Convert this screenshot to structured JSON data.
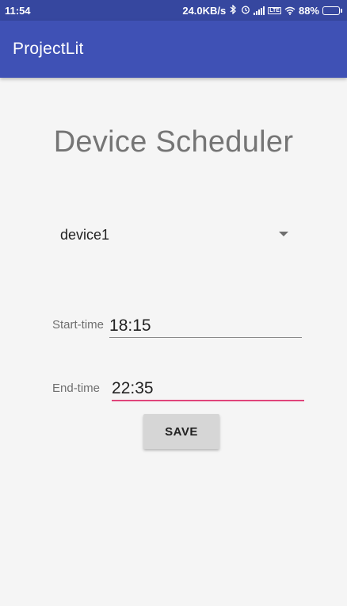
{
  "status_bar": {
    "time": "11:54",
    "network_speed": "24.0KB/s",
    "network_type_label": "LTE",
    "battery_text": "88%",
    "battery_level": 0.88,
    "icons": [
      "bluetooth-icon",
      "alarm-icon",
      "signal-icon",
      "lte-icon",
      "wifi-icon",
      "battery-icon"
    ]
  },
  "app_bar": {
    "title": "ProjectLit",
    "color": "#3f51b5",
    "status_color": "#36479f"
  },
  "main": {
    "title": "Device Scheduler",
    "device_spinner": {
      "selected": "device1"
    },
    "start_time": {
      "label": "Start-time",
      "value": "18:15"
    },
    "end_time": {
      "label": "End-time",
      "value": "22:35",
      "focus_color": "#e0447a"
    },
    "save_label": "SAVE"
  }
}
